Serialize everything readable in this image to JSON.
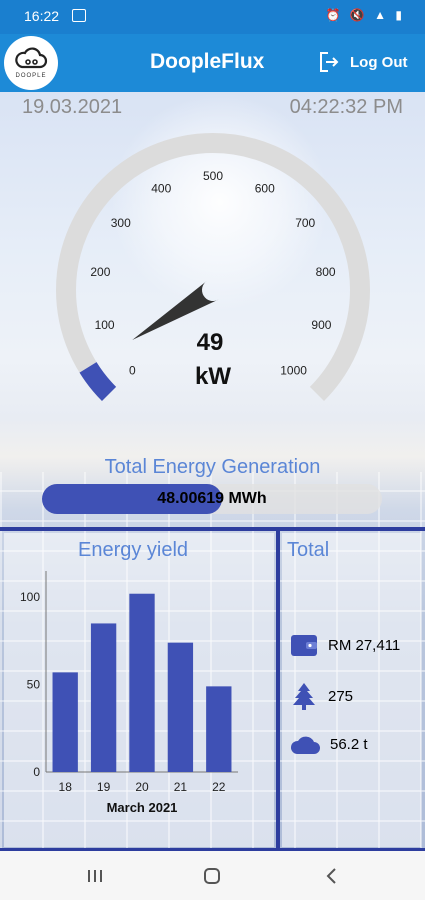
{
  "status_bar": {
    "time": "16:22"
  },
  "app": {
    "title": "DoopleFlux",
    "logo_text": "DOOPLE",
    "logout_label": "Log Out"
  },
  "header": {
    "date": "19.03.2021",
    "time": "04:22:32 PM"
  },
  "gauge": {
    "value": 49,
    "unit": "kW",
    "min": 0,
    "max": 1000,
    "ticks": [
      "0",
      "100",
      "200",
      "300",
      "400",
      "500",
      "600",
      "700",
      "800",
      "900",
      "1000"
    ],
    "colors": {
      "track": "#dcdcdc",
      "fill": "#3f51b5",
      "needle": "#333333"
    }
  },
  "generation": {
    "title": "Total Energy Generation",
    "value": "48.00619 MWh",
    "fill_fraction": 0.53
  },
  "energy_yield": {
    "title": "Energy yield",
    "chart_data": {
      "type": "bar",
      "categories": [
        "18",
        "19",
        "20",
        "21",
        "22"
      ],
      "values": [
        57,
        85,
        102,
        74,
        49
      ],
      "ylim": [
        0,
        115
      ],
      "yticks": [
        "0",
        "50",
        "100"
      ],
      "xlabel": "March 2021",
      "color": "#3f51b5"
    }
  },
  "total": {
    "title": "Total",
    "items": [
      {
        "icon": "wallet-icon",
        "value": "RM 27,411"
      },
      {
        "icon": "tree-icon",
        "value": "275"
      },
      {
        "icon": "cloud-icon",
        "value": "56.2 t"
      }
    ],
    "icon_color": "#3f51b5"
  }
}
